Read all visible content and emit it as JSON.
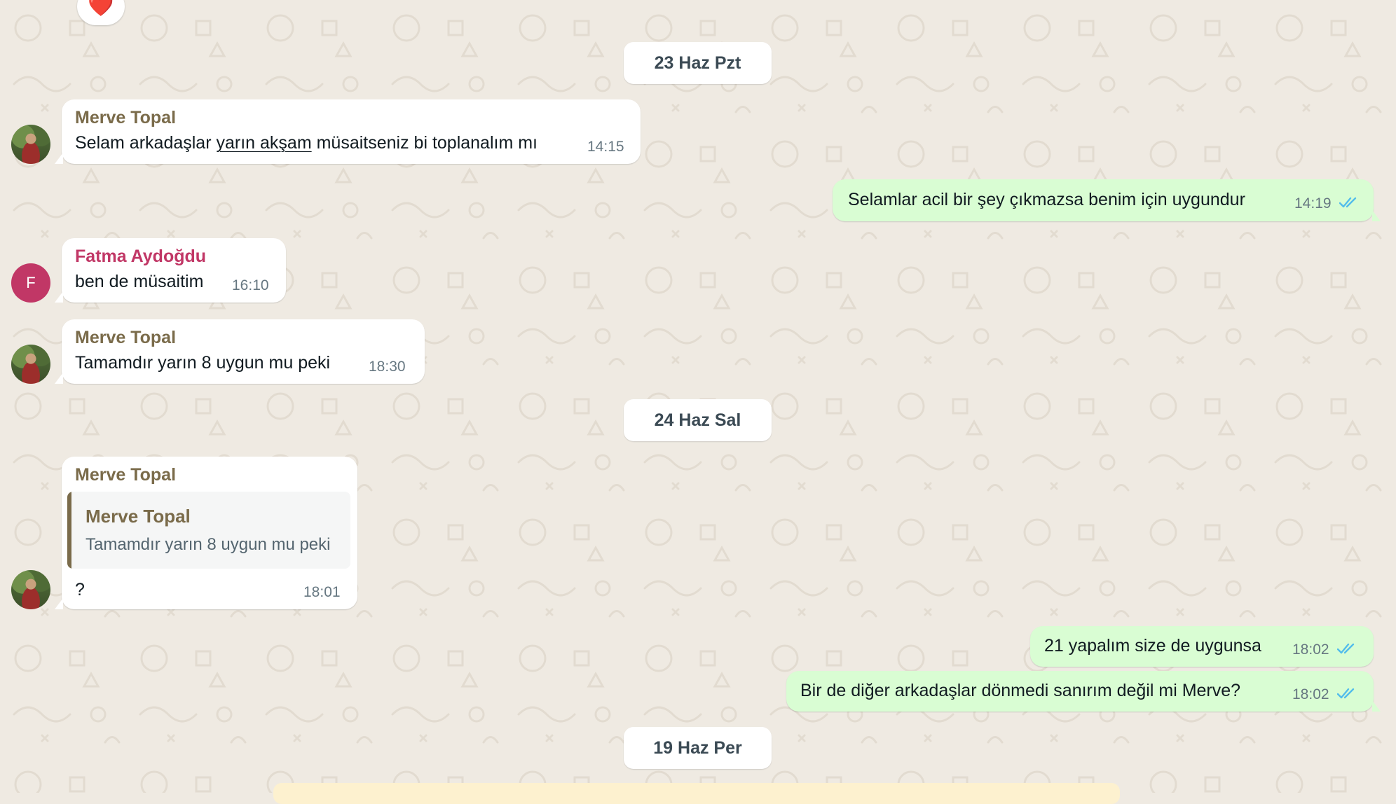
{
  "reaction": {
    "emoji": "❤️"
  },
  "dates": {
    "d1": "23 Haz Pzt",
    "d2": "24 Haz Sal",
    "d3": "19 Haz Per"
  },
  "m1": {
    "sender": "Merve Topal",
    "text_a": "Selam arkadaşlar ",
    "text_u": "yarın akşam",
    "text_b": " müsaitseniz bi toplanalım mı",
    "time": "14:15"
  },
  "m2": {
    "text": "Selamlar acil bir şey çıkmazsa benim için uygundur",
    "time": "14:19"
  },
  "m3": {
    "sender": "Fatma Aydoğdu",
    "avatar_letter": "F",
    "text": "ben de müsaitim",
    "time": "16:10"
  },
  "m4": {
    "sender": "Merve Topal",
    "text": "Tamamdır yarın 8 uygun mu peki",
    "time": "18:30"
  },
  "m5": {
    "sender": "Merve Topal",
    "quote_sender": "Merve Topal",
    "quote_text": "Tamamdır yarın 8 uygun mu peki",
    "text": "?",
    "time": "18:01"
  },
  "m6": {
    "text": "21 yapalım size de uygunsa",
    "time": "18:02"
  },
  "m7": {
    "text": "Bir de diğer arkadaşlar dönmedi sanırım değil mi Merve?",
    "time": "18:02"
  },
  "colors": {
    "incoming": "#ffffff",
    "outgoing": "#d9fdd3",
    "sender_merve": "#7a6b4a",
    "sender_fatma": "#c13766",
    "read_ticks": "#53bdeb",
    "background": "#efeae2"
  }
}
